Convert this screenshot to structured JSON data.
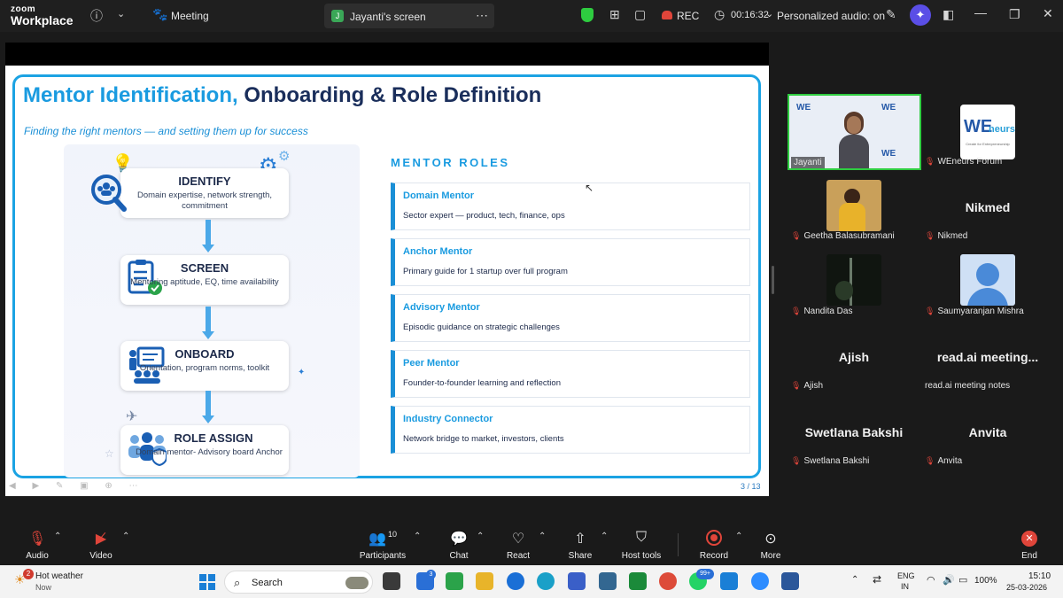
{
  "topbar": {
    "logo_line1": "zoom",
    "logo_line2": "Workplace",
    "meeting_label": "Meeting",
    "share_tab_label": "Jayanti's screen",
    "share_badge": "J",
    "rec_label": "REC",
    "timer": "00:16:32",
    "audio_label": "Personalized audio: on"
  },
  "slide": {
    "title_accent": "Mentor Identification,",
    "title_rest": "Onboarding & Role Definition",
    "subtitle": "Finding the right mentors — and setting them up for success",
    "page_number": "3 / 13",
    "steps": [
      {
        "title": "IDENTIFY",
        "desc": "Domain expertise, network strength, commitment"
      },
      {
        "title": "SCREEN",
        "desc": "Mentoring aptitude, EQ, time availability"
      },
      {
        "title": "ONBOARD",
        "desc": "Orientation, program norms, toolkit"
      },
      {
        "title": "ROLE ASSIGN",
        "desc": "Domain mentor- Advisory board Anchor"
      }
    ],
    "roles_heading": "MENTOR ROLES",
    "roles": [
      {
        "name": "Domain Mentor",
        "desc": "Sector expert — product, tech, finance, ops"
      },
      {
        "name": "Anchor Mentor",
        "desc": "Primary guide for 1 startup over full program"
      },
      {
        "name": "Advisory Mentor",
        "desc": "Episodic guidance on strategic challenges"
      },
      {
        "name": "Peer Mentor",
        "desc": "Founder-to-founder learning and reflection"
      },
      {
        "name": "Industry Connector",
        "desc": "Network bridge to market, investors, clients"
      }
    ]
  },
  "participants": {
    "jayanti": "Jayanti",
    "weneurs": "WEneurs Forum",
    "weneurs_logo_main": "WE",
    "weneurs_logo_sub": "neurs",
    "weneurs_tagline": "Create for Entrepreneurship",
    "geetha": "Geetha Balasubramani",
    "nikmed_big": "Nikmed",
    "nikmed": "Nikmed",
    "nandita": "Nandita Das",
    "saumya": "Saumyaranjan Mishra",
    "ajish_big": "Ajish",
    "ajish": "Ajish",
    "readai_big": "read.ai meeting...",
    "readai": "read.ai meeting notes",
    "swetlana_big": "Swetlana Bakshi",
    "swetlana": "Swetlana Bakshi",
    "anvita_big": "Anvita",
    "anvita": "Anvita"
  },
  "toolbar": {
    "audio": "Audio",
    "video": "Video",
    "participants": "Participants",
    "participants_count": "10",
    "chat": "Chat",
    "react": "React",
    "share": "Share",
    "host_tools": "Host tools",
    "record": "Record",
    "more": "More",
    "end": "End"
  },
  "taskbar": {
    "weather_title": "Hot weather",
    "weather_sub": "Now",
    "weather_badge": "2",
    "search": "Search",
    "todo_badge": "3",
    "whatsapp_badge": "99+",
    "lang1": "ENG",
    "lang2": "IN",
    "battery": "100%",
    "time": "15:10",
    "date": "25-03-2026"
  },
  "colors": {
    "accent_blue": "#1a9be0",
    "title_navy": "#1a2e5b",
    "active_speaker_border": "#2ecc40",
    "record_red": "#e0453a"
  }
}
